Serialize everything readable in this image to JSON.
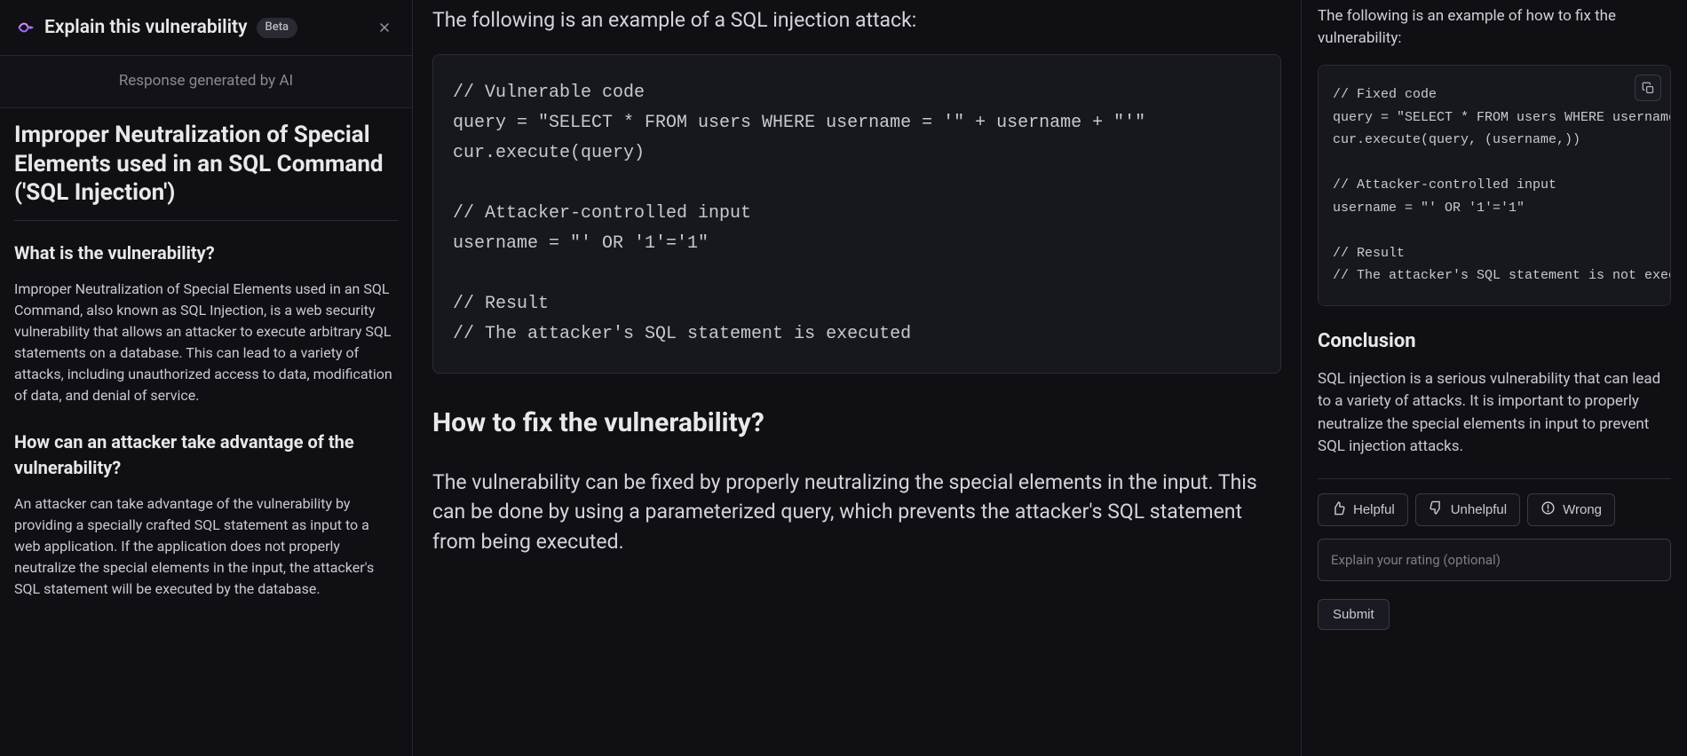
{
  "header": {
    "title": "Explain this vulnerability",
    "badge": "Beta"
  },
  "ai_note": "Response generated by AI",
  "left": {
    "vuln_title": "Improper Neutralization of Special Elements used in an SQL Command ('SQL Injection')",
    "section1_heading": "What is the vulnerability?",
    "section1_body": "Improper Neutralization of Special Elements used in an SQL Command, also known as SQL Injection, is a web security vulnerability that allows an attacker to execute arbitrary SQL statements on a database. This can lead to a variety of attacks, including unauthorized access to data, modification of data, and denial of service.",
    "section2_heading": "How can an attacker take advantage of the vulnerability?",
    "section2_body": "An attacker can take advantage of the vulnerability by providing a specially crafted SQL statement as input to a web application. If the application does not properly neutralize the special elements in the input, the attacker's SQL statement will be executed by the database."
  },
  "middle": {
    "example_intro": "The following is an example of a SQL injection attack:",
    "code_vuln": "// Vulnerable code\nquery = \"SELECT * FROM users WHERE username = '\" + username + \"'\"\ncur.execute(query)\n\n// Attacker-controlled input\nusername = \"' OR '1'='1\"\n\n// Result\n// The attacker's SQL statement is executed",
    "fix_heading": "How to fix the vulnerability?",
    "fix_body": "The vulnerability can be fixed by properly neutralizing the special elements in the input. This can be done by using a parameterized query, which prevents the attacker's SQL statement from being executed."
  },
  "right": {
    "intro": "The following is an example of how to fix the vulnerability:",
    "code_fix": "// Fixed code\nquery = \"SELECT * FROM users WHERE username = %s\"\ncur.execute(query, (username,))\n\n// Attacker-controlled input\nusername = \"' OR '1'='1\"\n\n// Result\n// The attacker's SQL statement is not executed",
    "conclusion_heading": "Conclusion",
    "conclusion_body": "SQL injection is a serious vulnerability that can lead to a variety of attacks. It is important to properly neutralize the special elements in input to prevent SQL injection attacks."
  },
  "feedback": {
    "helpful": "Helpful",
    "unhelpful": "Unhelpful",
    "wrong": "Wrong",
    "placeholder": "Explain your rating (optional)",
    "submit": "Submit"
  }
}
